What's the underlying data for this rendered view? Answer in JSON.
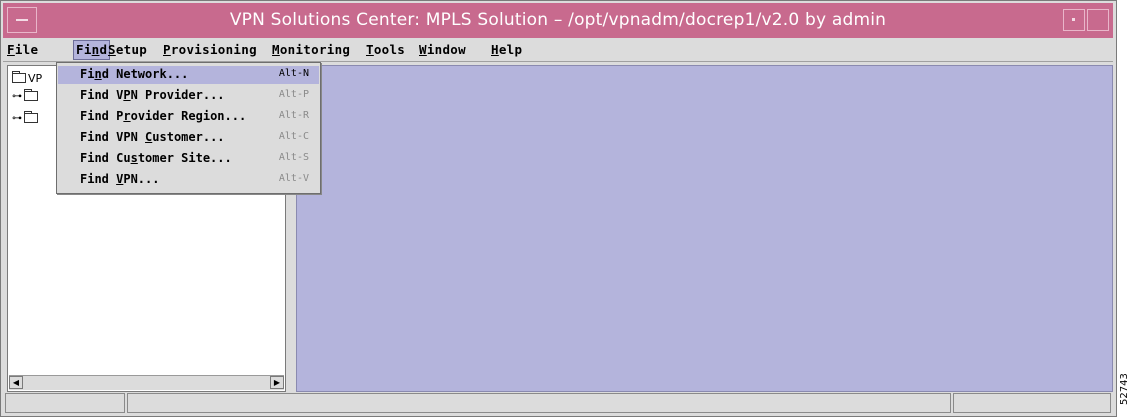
{
  "window": {
    "title": "VPN Solutions Center: MPLS Solution – /opt/vpnadm/docrep1/v2.0 by admin"
  },
  "menubar": {
    "items": [
      {
        "label": "File",
        "ul": "F"
      },
      {
        "label": "Find",
        "ul": "n"
      },
      {
        "label": "Setup",
        "ul": "S"
      },
      {
        "label": "Provisioning",
        "ul": "P"
      },
      {
        "label": "Monitoring",
        "ul": "M"
      },
      {
        "label": "Tools",
        "ul": "T"
      },
      {
        "label": "Window",
        "ul": "W"
      },
      {
        "label": "Help",
        "ul": "H"
      }
    ],
    "active_menu": "Find"
  },
  "find_menu": {
    "items": [
      {
        "pre": "Fi",
        "ul": "n",
        "post": "d Network...",
        "accel": "Alt-N",
        "selected": true
      },
      {
        "pre": "Find V",
        "ul": "P",
        "post": "N Provider...",
        "accel": "Alt-P"
      },
      {
        "pre": "Find P",
        "ul": "r",
        "post": "ovider Region...",
        "accel": "Alt-R"
      },
      {
        "pre": "Find VPN ",
        "ul": "C",
        "post": "ustomer...",
        "accel": "Alt-C"
      },
      {
        "pre": "Find Cu",
        "ul": "s",
        "post": "tomer Site...",
        "accel": "Alt-S"
      },
      {
        "pre": "Find ",
        "ul": "V",
        "post": "PN...",
        "accel": "Alt-V"
      }
    ]
  },
  "tree": {
    "root_label": "VP",
    "children_count_visible": 2
  },
  "figure_id": "52743",
  "colors": {
    "titlebar": "#c86a8e",
    "selection": "#b4b4dc",
    "content_bg": "#b4b4dc"
  }
}
